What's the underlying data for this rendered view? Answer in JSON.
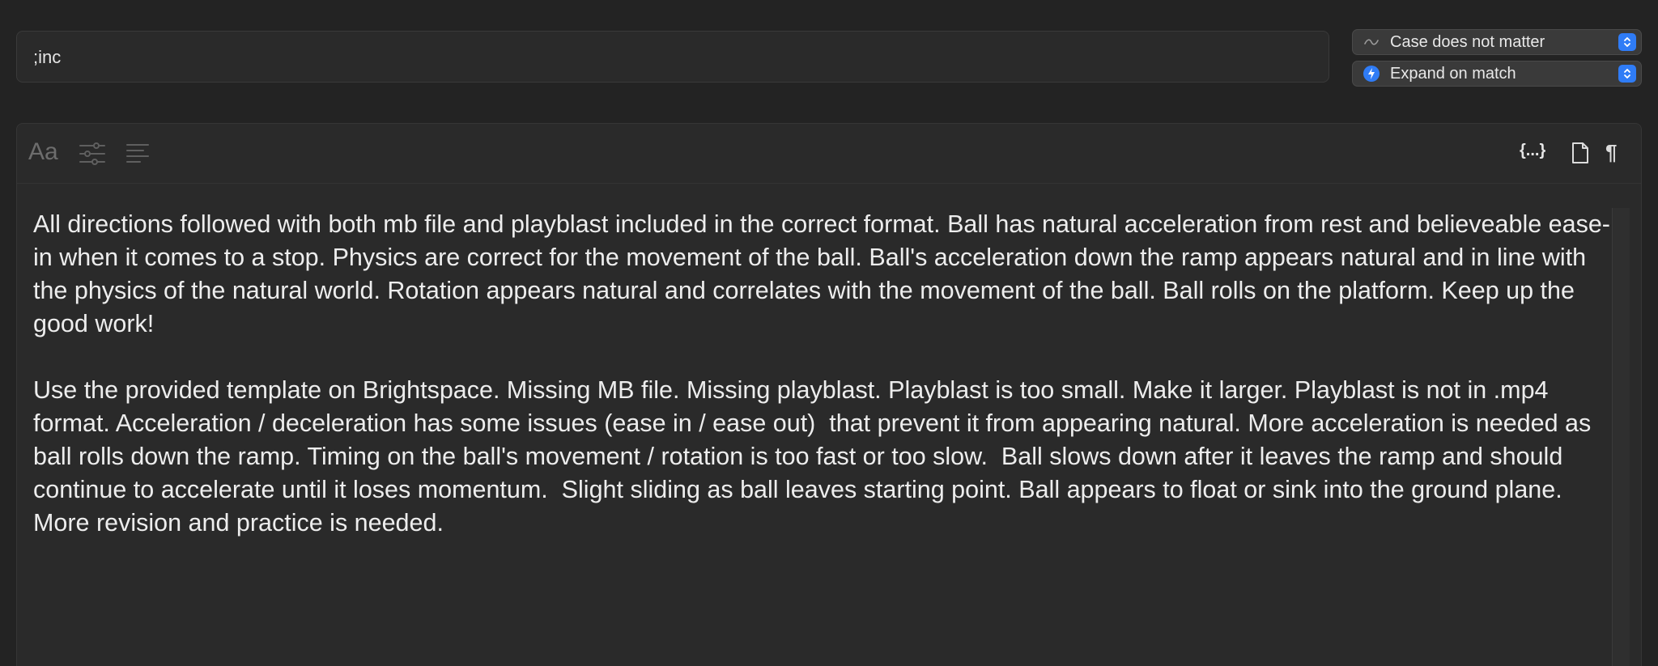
{
  "abbreviation": {
    "value": ";inc"
  },
  "case_popup": {
    "selected": "Case does not matter",
    "icon": "tilde-icon"
  },
  "expand_popup": {
    "selected": "Expand on match",
    "icon": "lightning-bolt-icon"
  },
  "toolbar": {
    "font_label": "Aa",
    "placeholder_label": "{...}"
  },
  "snippet": {
    "paragraphs": [
      "All directions followed with both mb file and playblast included in the correct format. Ball has natural acceleration from rest and believeable ease-in when it comes to a stop. Physics are correct for the movement of the ball. Ball's acceleration down the ramp appears natural and in line with the physics of the natural world. Rotation appears natural and correlates with the movement of the ball. Ball rolls on the platform. Keep up the good work!",
      "Use the provided template on Brightspace. Missing MB file. Missing playblast. Playblast is too small. Make it larger. Playblast is not in .mp4 format. Acceleration / deceleration has some issues (ease in / ease out)  that prevent it from appearing natural. More acceleration is needed as ball rolls down the ramp. Timing on the ball's movement / rotation is too fast or too slow.  Ball slows down after it leaves the ramp and should continue to accelerate until it loses momentum.  Slight sliding as ball leaves starting point. Ball appears to float or sink into the ground plane. More revision and practice is needed."
    ]
  },
  "colors": {
    "background": "#232323",
    "panel": "#2a2a2a",
    "accent": "#2f7cf6",
    "text": "#ededed"
  }
}
